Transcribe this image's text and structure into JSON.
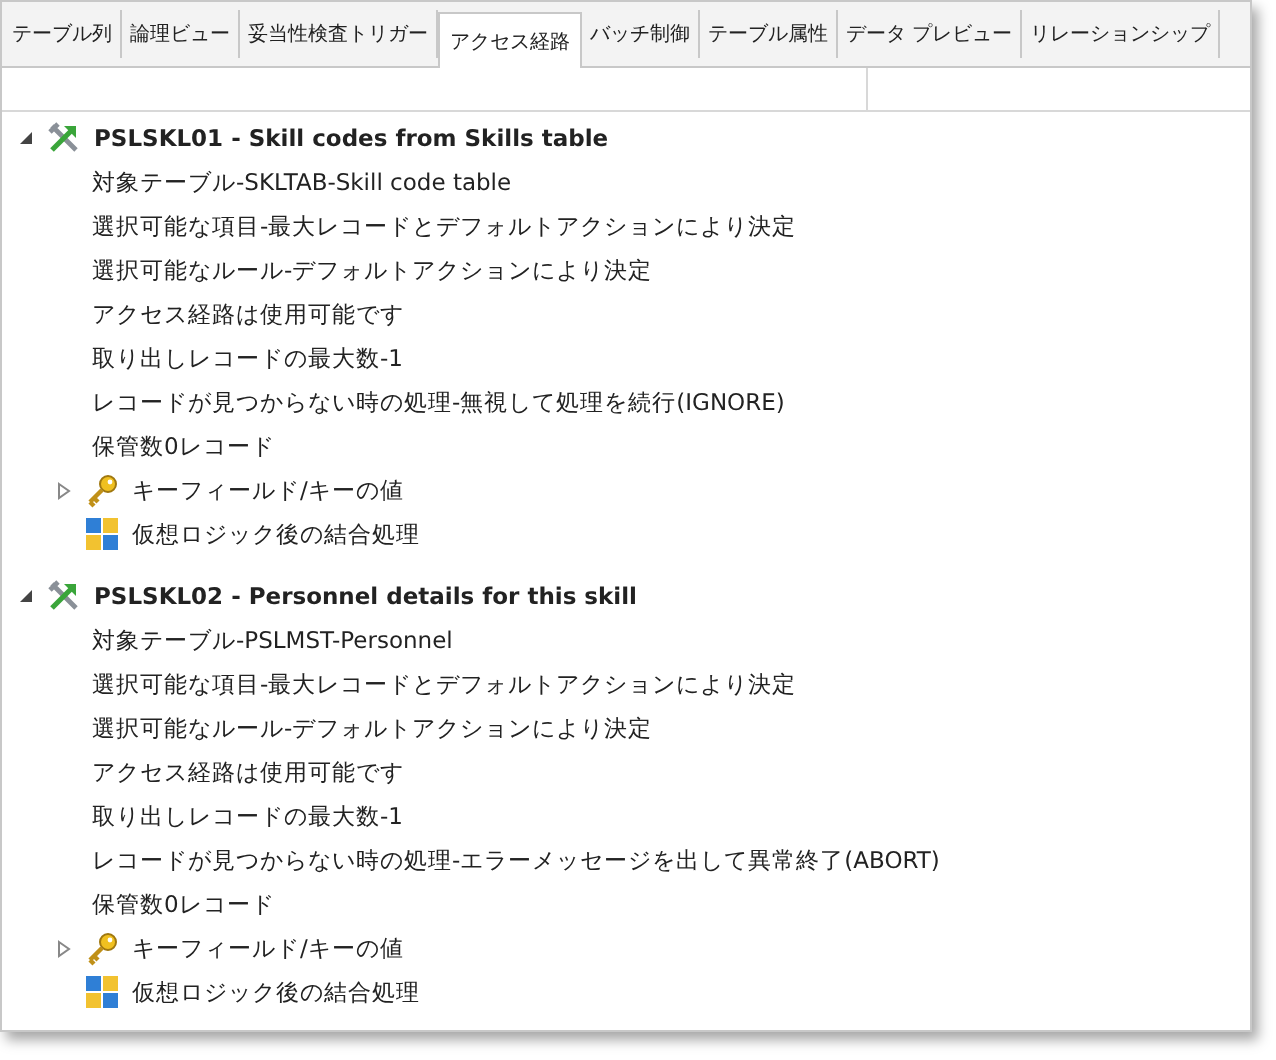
{
  "tabs": [
    {
      "label": "テーブル列",
      "selected": false
    },
    {
      "label": "論理ビュー",
      "selected": false
    },
    {
      "label": "妥当性検査トリガー",
      "selected": false
    },
    {
      "label": "アクセス経路",
      "selected": true
    },
    {
      "label": "バッチ制御",
      "selected": false
    },
    {
      "label": "テーブル属性",
      "selected": false
    },
    {
      "label": "データ プレビュー",
      "selected": false
    },
    {
      "label": "リレーションシップ",
      "selected": false
    }
  ],
  "tree": [
    {
      "kind": "path",
      "label": "PSLSKL01 - Skill codes from Skills table",
      "expanded": true,
      "children": [
        {
          "kind": "text",
          "label": "対象テーブル-SKLTAB-Skill code table"
        },
        {
          "kind": "text",
          "label": "選択可能な項目-最大レコードとデフォルトアクションにより決定"
        },
        {
          "kind": "text",
          "label": "選択可能なルール-デフォルトアクションにより決定"
        },
        {
          "kind": "text",
          "label": "アクセス経路は使用可能です"
        },
        {
          "kind": "text",
          "label": "取り出しレコードの最大数-1"
        },
        {
          "kind": "text",
          "label": "レコードが見つからない時の処理-無視して処理を続行(IGNORE)"
        },
        {
          "kind": "text",
          "label": "保管数0レコード"
        },
        {
          "kind": "key",
          "label": "キーフィールド/キーの値",
          "expanded": false
        },
        {
          "kind": "join",
          "label": "仮想ロジック後の結合処理"
        }
      ]
    },
    {
      "kind": "path",
      "label": "PSLSKL02 - Personnel details for this skill",
      "expanded": true,
      "children": [
        {
          "kind": "text",
          "label": "対象テーブル-PSLMST-Personnel"
        },
        {
          "kind": "text",
          "label": "選択可能な項目-最大レコードとデフォルトアクションにより決定"
        },
        {
          "kind": "text",
          "label": "選択可能なルール-デフォルトアクションにより決定"
        },
        {
          "kind": "text",
          "label": "アクセス経路は使用可能です"
        },
        {
          "kind": "text",
          "label": "取り出しレコードの最大数-1"
        },
        {
          "kind": "text",
          "label": "レコードが見つからない時の処理-エラーメッセージを出して異常終了(ABORT)"
        },
        {
          "kind": "text",
          "label": "保管数0レコード"
        },
        {
          "kind": "key",
          "label": "キーフィールド/キーの値",
          "expanded": false
        },
        {
          "kind": "join",
          "label": "仮想ロジック後の結合処理"
        }
      ]
    }
  ]
}
